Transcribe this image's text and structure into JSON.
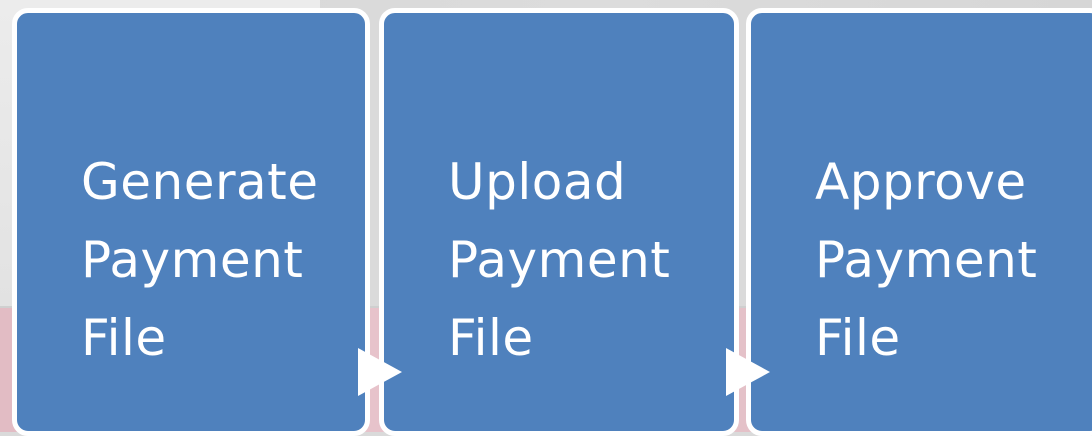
{
  "steps": [
    {
      "lines": [
        "Generate",
        "Payment",
        "File"
      ]
    },
    {
      "lines": [
        "Upload",
        "Payment",
        "File"
      ]
    },
    {
      "lines": [
        "Approve",
        "Payment",
        "File"
      ]
    }
  ],
  "colors": {
    "box_fill": "#4f81bd",
    "box_border": "#ffffff",
    "text": "#ffffff",
    "arrow": "#ffffff"
  },
  "connectors": [
    {
      "from": 1,
      "to": 2,
      "shape": "triangle-arrow"
    },
    {
      "from": 2,
      "to": 3,
      "shape": "triangle-arrow"
    }
  ]
}
